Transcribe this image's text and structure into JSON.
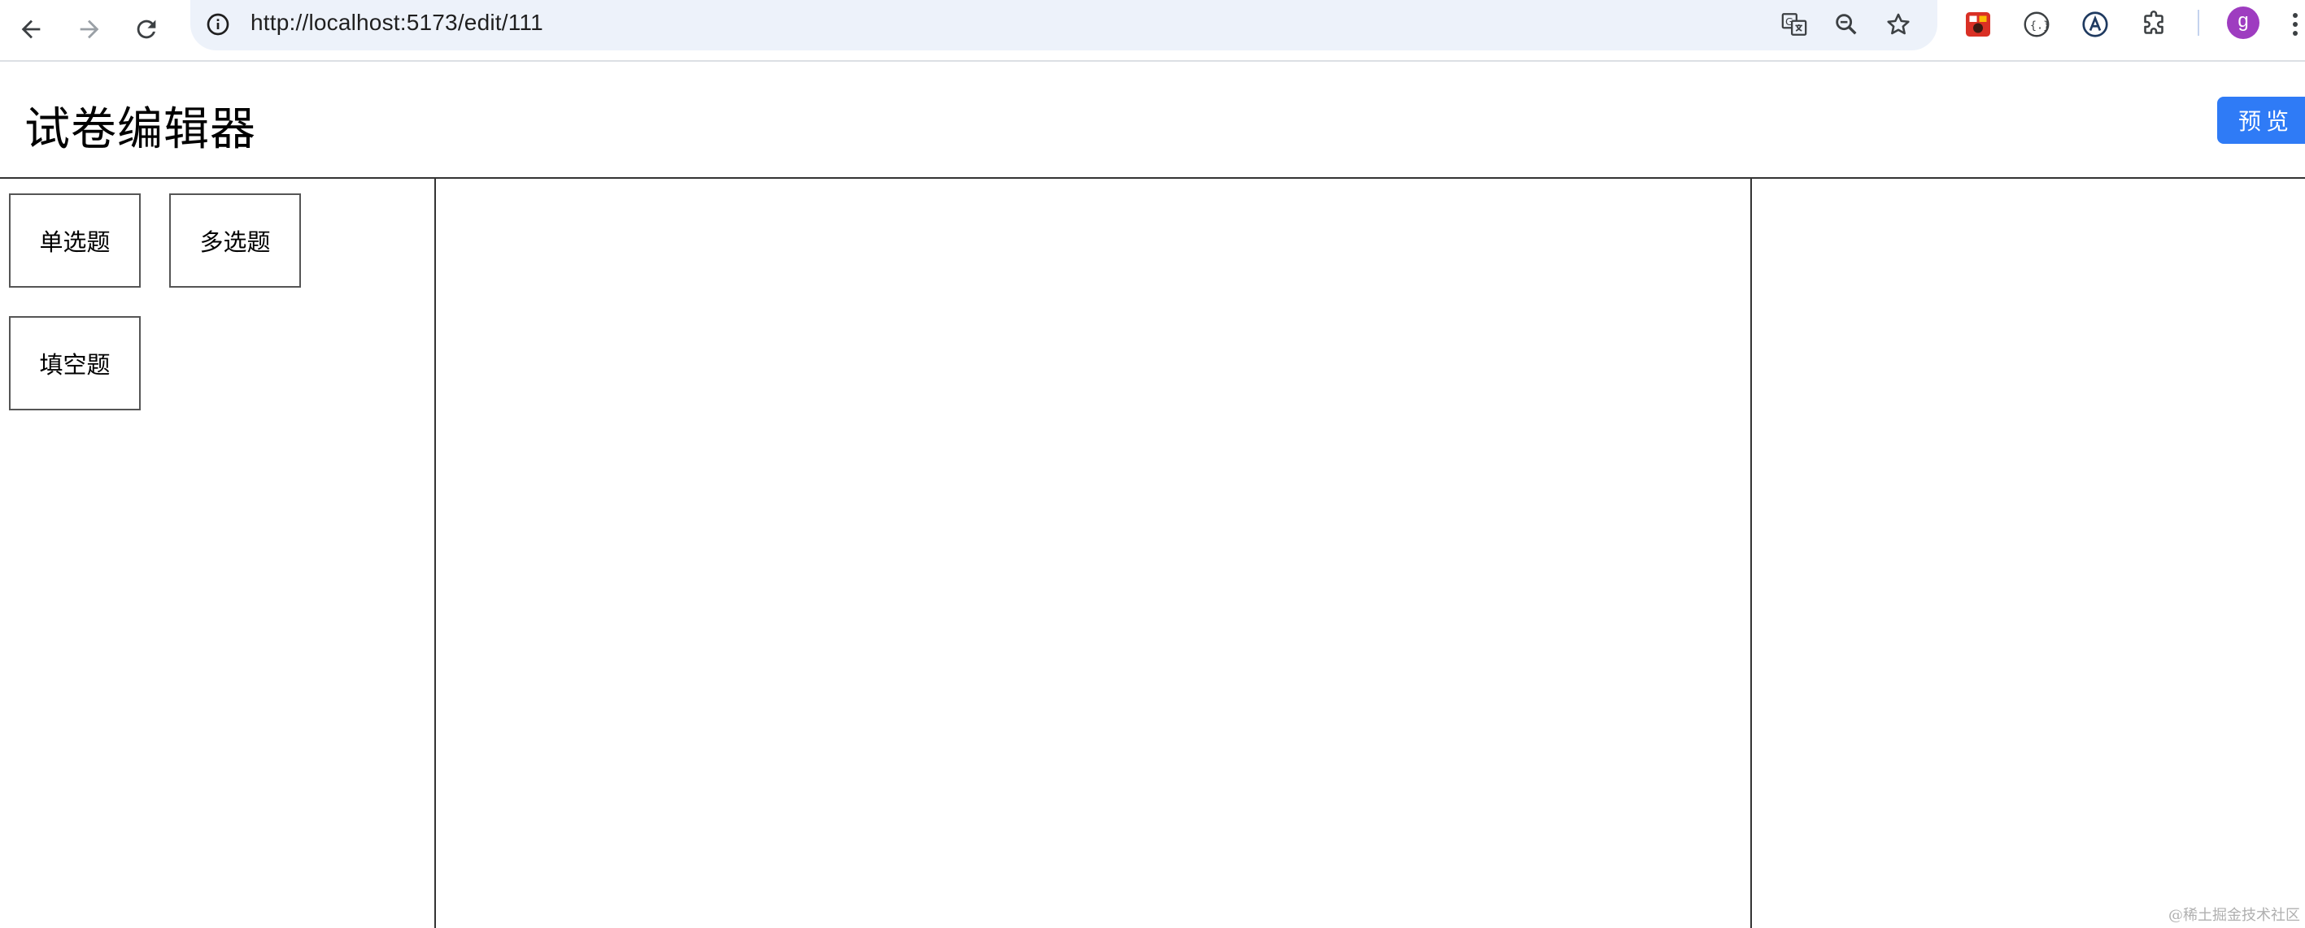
{
  "browser": {
    "url": "http://localhost:5173/edit/111",
    "avatar_letter": "g",
    "icons": {
      "back": "arrow-left-icon",
      "forward": "arrow-right-icon",
      "reload": "reload-icon",
      "site_info": "info-icon",
      "translate": "translate-icon",
      "zoom": "zoom-out-icon",
      "bookmark": "star-icon",
      "extensions": [
        "red-extension-icon",
        "braces-extension-icon",
        "a-circle-extension-icon",
        "puzzle-icon"
      ],
      "menu": "kebab-menu-icon"
    }
  },
  "header": {
    "title": "试卷编辑器",
    "preview_label": "预览"
  },
  "sidebar": {
    "question_types": [
      {
        "label": "单选题"
      },
      {
        "label": "多选题"
      },
      {
        "label": "填空题"
      }
    ]
  },
  "watermark": "@稀土掘金技术社区",
  "colors": {
    "primary": "#2f7bf6",
    "omnibox_bg": "#edf2fa",
    "border": "#333333",
    "avatar_bg": "#9e3cc0"
  }
}
